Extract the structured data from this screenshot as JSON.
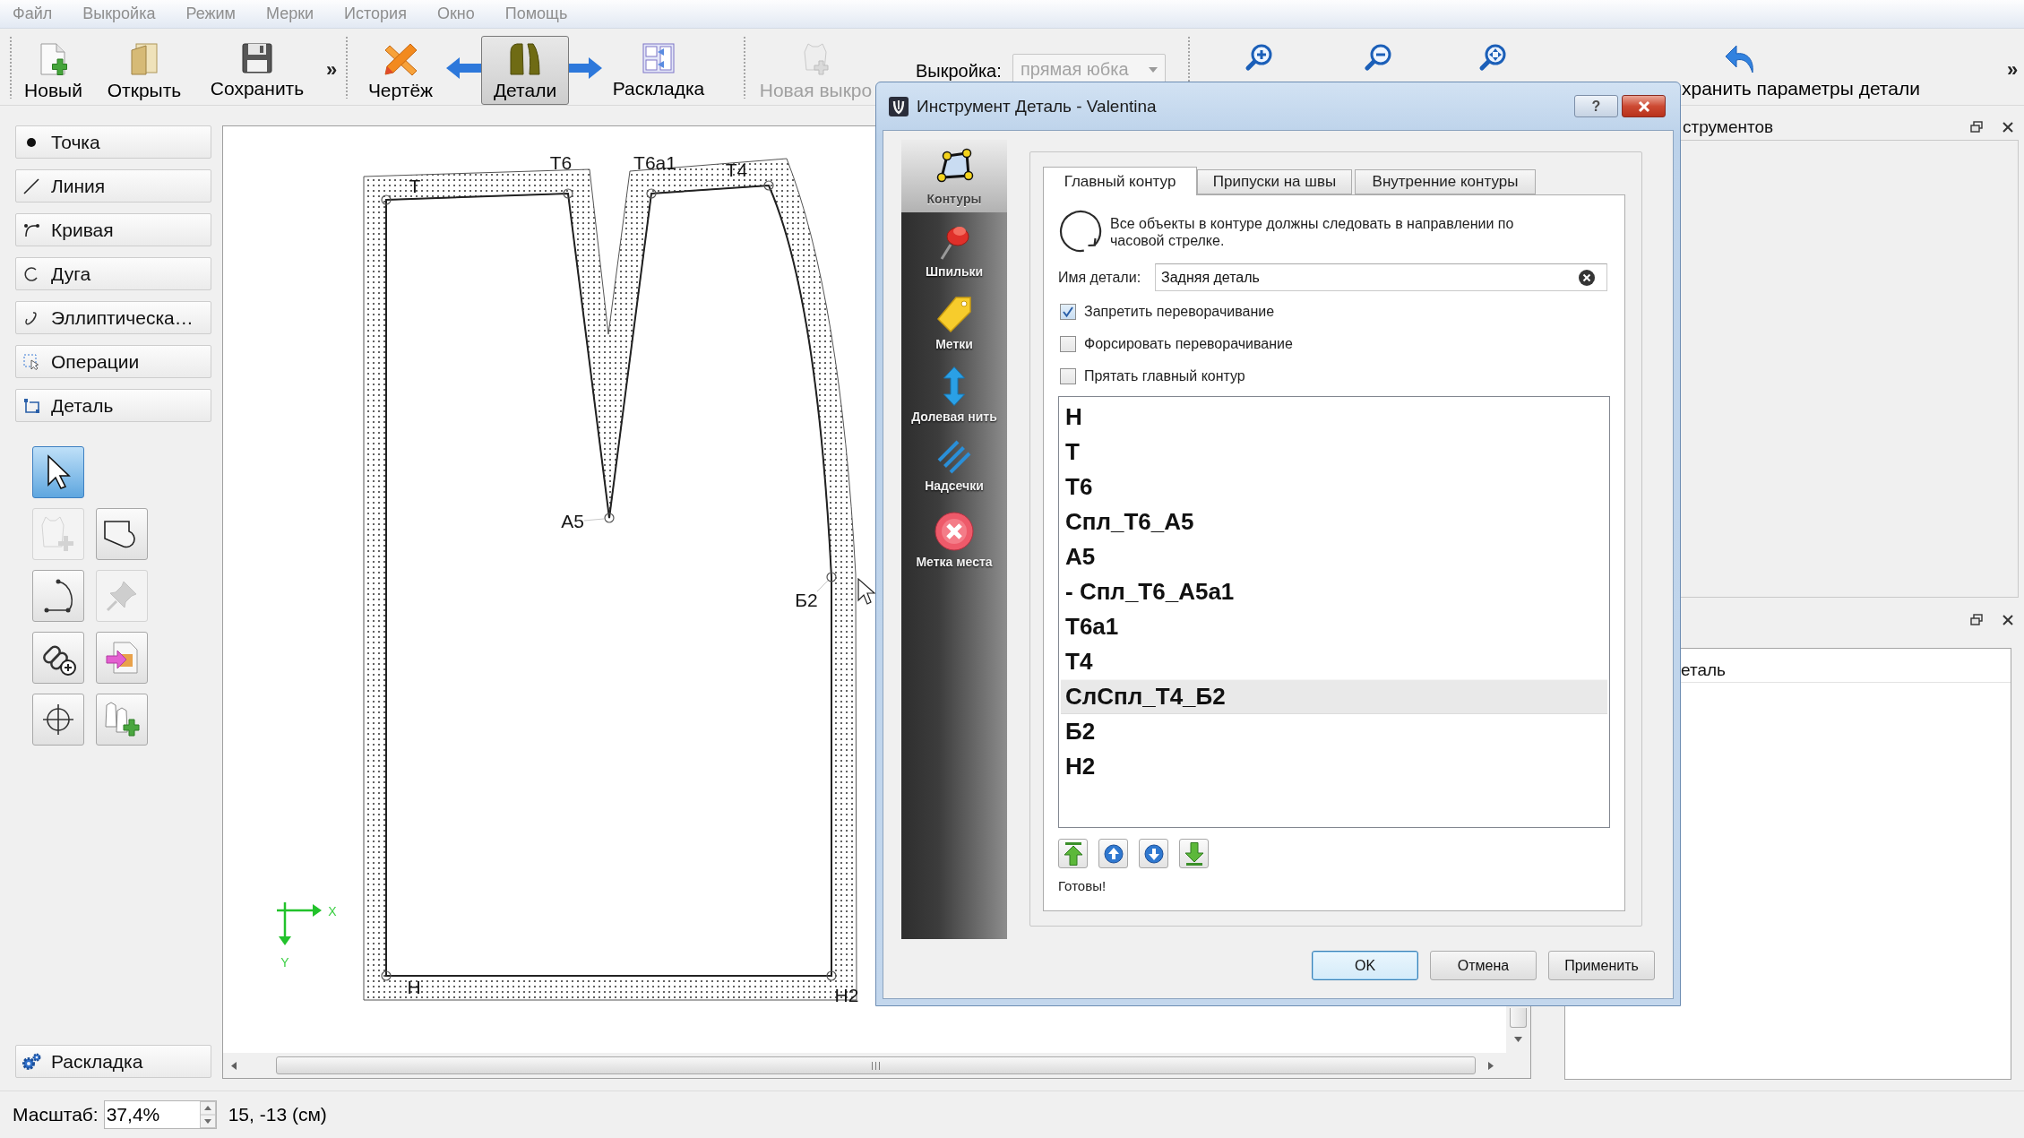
{
  "menu_bar": [
    {
      "label": "Файл",
      "disabled": true
    },
    {
      "label": "Выкройка",
      "disabled": true
    },
    {
      "label": "Режим",
      "disabled": true
    },
    {
      "label": "Мерки",
      "disabled": true
    },
    {
      "label": "История",
      "disabled": true
    },
    {
      "label": "Окно",
      "disabled": true
    },
    {
      "label": "Помощь",
      "disabled": true
    }
  ],
  "toolbar": {
    "file_buttons": [
      {
        "label": "Новый"
      },
      {
        "label": "Открыть"
      },
      {
        "label": "Сохранить"
      }
    ],
    "file_overflow": "»",
    "mode_buttons": [
      {
        "label": "Чертёж",
        "selected": false
      },
      {
        "label": "Детали",
        "selected": true
      },
      {
        "label": "Раскладка",
        "selected": false
      }
    ],
    "new_pattern_button": {
      "label": "Новая выкро",
      "disabled": true
    },
    "pattern_label": "Выкройка:",
    "pattern_combo": {
      "value": "прямая юбка",
      "disabled": true
    },
    "save_details_button": {
      "label": "хранить параметры детали"
    },
    "overflow": "»"
  },
  "tool_categories": [
    {
      "label": "Точка"
    },
    {
      "label": "Линия"
    },
    {
      "label": "Кривая"
    },
    {
      "label": "Дуга"
    },
    {
      "label": "Эллиптическа…"
    },
    {
      "label": "Операции"
    },
    {
      "label": "Деталь"
    }
  ],
  "tool_grid": [
    {
      "selected": true,
      "disabled": false
    },
    {
      "selected": false,
      "disabled": true
    },
    {
      "selected": false,
      "disabled": false
    },
    {
      "selected": false,
      "disabled": false
    },
    {
      "selected": false,
      "disabled": true
    },
    {
      "selected": false,
      "disabled": false
    },
    {
      "selected": false,
      "disabled": false
    },
    {
      "selected": false,
      "disabled": false
    },
    {
      "selected": false,
      "disabled": false
    }
  ],
  "layout_button": {
    "label": "Раскладка"
  },
  "canvas": {
    "point_labels": [
      "Т",
      "Т6",
      "Т6а1",
      "Т4",
      "А5",
      "Б2",
      "Н",
      "Н2"
    ],
    "axis_labels": [
      "X",
      "Y"
    ]
  },
  "tool_options_dock": {
    "title": "струментов"
  },
  "lower_dock": {
    "items": [
      "еталь"
    ]
  },
  "status_bar": {
    "scale_label": "Масштаб:",
    "scale_value": "37,4%",
    "coordinates": "15, -13 (см)"
  },
  "dialog": {
    "title": "Инструмент Деталь - Valentina",
    "help_button": "?",
    "sections": [
      {
        "label": "Контуры",
        "selected": true
      },
      {
        "label": "Шпильки",
        "selected": false
      },
      {
        "label": "Метки",
        "selected": false
      },
      {
        "label": "Долевая нить",
        "selected": false
      },
      {
        "label": "Надсечки",
        "selected": false
      },
      {
        "label": "Метка места",
        "selected": false
      }
    ],
    "tabs": [
      {
        "label": "Главный контур",
        "selected": true
      },
      {
        "label": "Припуски на швы",
        "selected": false
      },
      {
        "label": "Внутренние контуры",
        "selected": false
      }
    ],
    "hint": "Все объекты в контуре должны следовать в направлении по часовой стрелке.",
    "name_field": {
      "label": "Имя детали:",
      "value": "Задняя деталь"
    },
    "checkboxes": [
      {
        "label": "Запретить переворачивание",
        "checked": true
      },
      {
        "label": "Форсировать переворачивание",
        "checked": false
      },
      {
        "label": "Прятать главный контур",
        "checked": false
      }
    ],
    "path_items": [
      {
        "label": "Н",
        "selected": false
      },
      {
        "label": "Т",
        "selected": false
      },
      {
        "label": "Т6",
        "selected": false
      },
      {
        "label": "Спл_Т6_А5",
        "selected": false
      },
      {
        "label": "А5",
        "selected": false
      },
      {
        "label": "- Спл_Т6_А5а1",
        "selected": false
      },
      {
        "label": "Т6а1",
        "selected": false
      },
      {
        "label": "Т4",
        "selected": false
      },
      {
        "label": "СлСпл_Т4_Б2",
        "selected": true
      },
      {
        "label": "Б2",
        "selected": false
      },
      {
        "label": "Н2",
        "selected": false
      }
    ],
    "status": "Готовы!",
    "buttons": [
      {
        "label": "OK",
        "default": true
      },
      {
        "label": "Отмена",
        "default": false
      },
      {
        "label": "Применить",
        "default": false
      }
    ]
  }
}
